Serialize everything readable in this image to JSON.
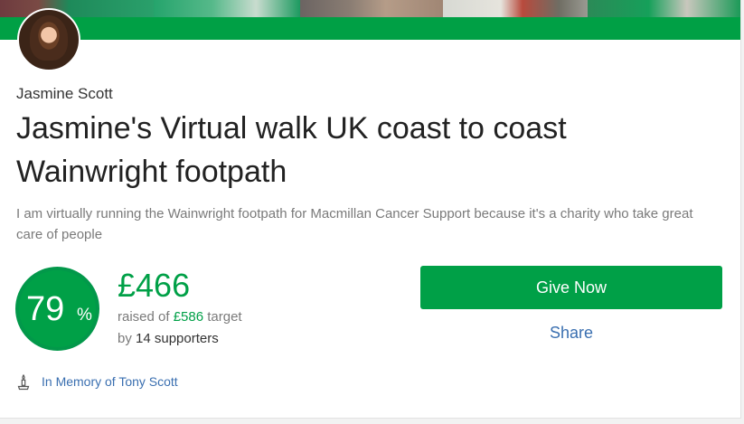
{
  "fundraiser": {
    "owner": "Jasmine Scott",
    "title": "Jasmine's Virtual walk UK coast to coast Wainwright footpath",
    "description": "I am virtually running the Wainwright footpath for Macmillan Cancer Support because it's a charity who take great care of people"
  },
  "progress": {
    "percent_value": "79",
    "percent_sign": "%",
    "fraction": 0.79,
    "raised_amount": "£466",
    "raised_prefix": "raised of ",
    "target_amount": "£586",
    "target_suffix": " target",
    "supporters_prefix": "by ",
    "supporters_count": "14 supporters"
  },
  "actions": {
    "give_label": "Give Now",
    "share_label": "Share"
  },
  "memory": {
    "icon": "memorial-candle-icon",
    "label": "In Memory of Tony Scott"
  },
  "colors": {
    "brand_green": "#00a047",
    "link_blue": "#3a6fb0",
    "muted_text": "#7a7a7a"
  }
}
